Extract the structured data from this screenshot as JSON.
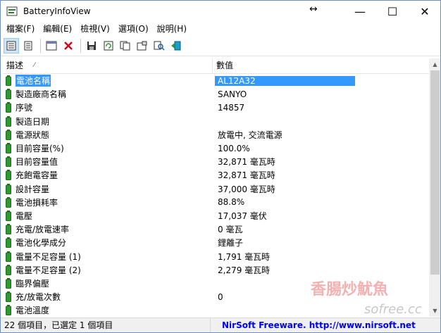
{
  "window": {
    "title": "BatteryInfoView",
    "resize_glyph": "↔",
    "min": "—",
    "max": "☐",
    "close": "✕"
  },
  "menu": [
    "檔案(F)",
    "編輯(E)",
    "檢視(V)",
    "選項(O)",
    "說明(H)"
  ],
  "toolbar": {
    "icons": [
      "battery-info-icon",
      "battery-log-icon",
      "html-report-icon",
      "delete-icon",
      "save-icon",
      "refresh-icon",
      "copy-icon",
      "properties-icon",
      "find-icon",
      "exit-icon"
    ]
  },
  "columns": {
    "desc": "描述",
    "value": "數值",
    "sort_glyph": "⁄"
  },
  "rows": [
    {
      "desc": "電池名稱",
      "value": "AL12A32",
      "selected": true
    },
    {
      "desc": "製造廠商名稱",
      "value": "SANYO"
    },
    {
      "desc": "序號",
      "value": "14857"
    },
    {
      "desc": "製造日期",
      "value": ""
    },
    {
      "desc": "電源狀態",
      "value": "放電中, 交流電源"
    },
    {
      "desc": "目前容量(%)",
      "value": "100.0%"
    },
    {
      "desc": "目前容量值",
      "value": "32,871 毫瓦時"
    },
    {
      "desc": "充飽電容量",
      "value": "32,871 毫瓦時"
    },
    {
      "desc": "設計容量",
      "value": "37,000 毫瓦時"
    },
    {
      "desc": "電池損耗率",
      "value": "88.8%"
    },
    {
      "desc": "電壓",
      "value": "17,037 毫伏"
    },
    {
      "desc": "充電/放電速率",
      "value": "0 毫瓦"
    },
    {
      "desc": "電池化學成分",
      "value": "鋰離子"
    },
    {
      "desc": "電量不足容量 (1)",
      "value": "1,791 毫瓦時"
    },
    {
      "desc": "電量不足容量 (2)",
      "value": "2,279 毫瓦時"
    },
    {
      "desc": "臨界偏壓",
      "value": ""
    },
    {
      "desc": "充/放電次數",
      "value": "0"
    },
    {
      "desc": "電池溫度",
      "value": ""
    }
  ],
  "status": {
    "left": "22 個項目，已選定 1 個項目",
    "right": "NirSoft Freeware.  http://www.nirsoft.net"
  },
  "watermark": {
    "text": "香腸炒魷魚",
    "site": "sofree.cc"
  },
  "colors": {
    "selection": "#3399ff",
    "battery": "#2e9a2e",
    "link": "#0000ff"
  }
}
